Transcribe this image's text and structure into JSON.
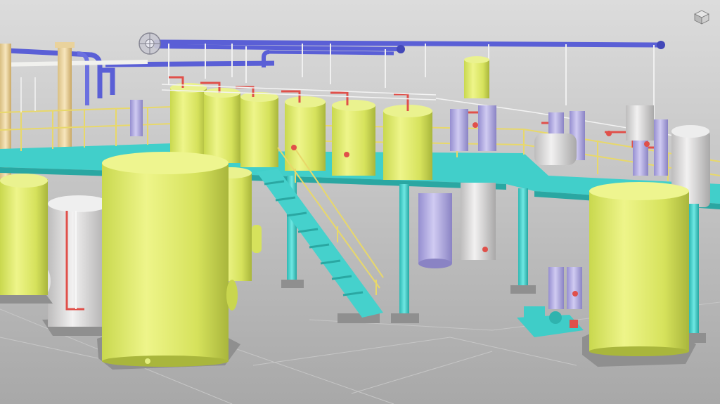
{
  "viewport": {
    "background_top": "#d9d9d9",
    "background_bottom": "#a6a6a6",
    "view_mode": "3D shaded"
  },
  "navigation": {
    "steering_wheel_icon": "steering-wheel-icon",
    "viewcube_icon": "viewcube-icon"
  },
  "colors": {
    "tank_yellow": "#e2ee6a",
    "tank_white": "#e8e6e6",
    "pipe_blue": "#5a5fd6",
    "pipe_red": "#e0504a",
    "pipe_yellow": "#f0d97a",
    "structure_cyan": "#46d9d4",
    "vessel_lavender": "#b6aee8",
    "column_tan": "#f1d9a2",
    "footing_gray": "#8f8f8f"
  },
  "scene": {
    "objects": [
      "storage-tank",
      "process-tank",
      "vessel",
      "pipe-rack",
      "stair",
      "platform",
      "column",
      "pump"
    ]
  }
}
